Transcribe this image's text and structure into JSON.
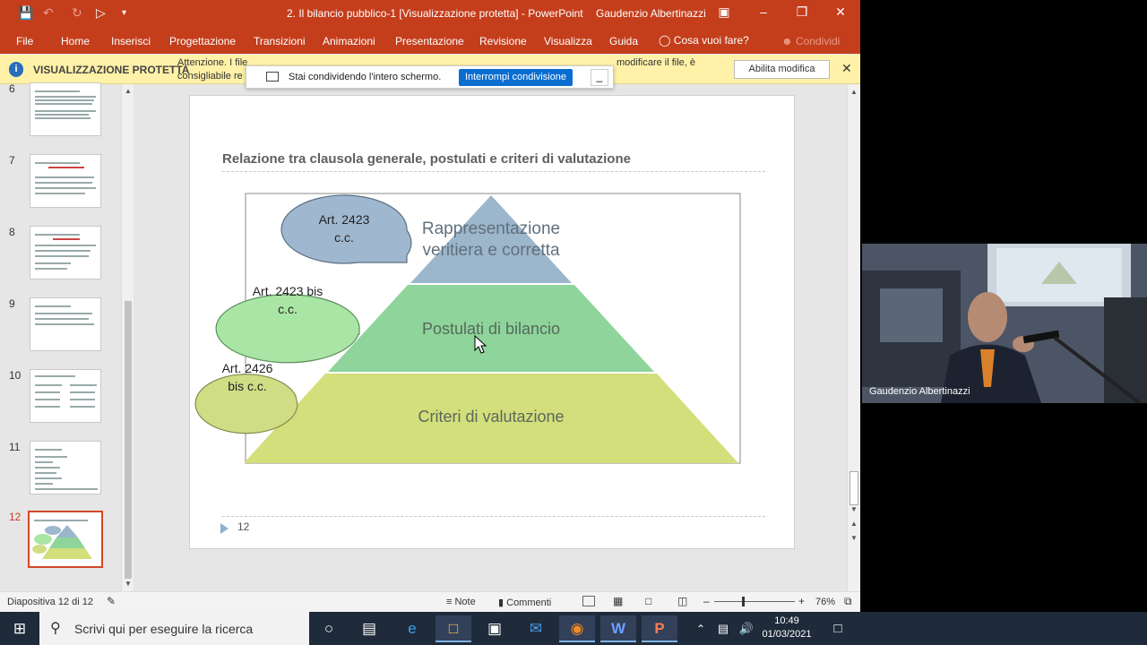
{
  "window": {
    "title": "2. Il bilancio pubblico-1 [Visualizzazione protetta]  -  PowerPoint",
    "user": "Gaudenzio Albertinazzi"
  },
  "ribbon": {
    "tabs": [
      "File",
      "Home",
      "Inserisci",
      "Progettazione",
      "Transizioni",
      "Animazioni",
      "Presentazione",
      "Revisione",
      "Visualizza",
      "Guida"
    ],
    "tell_me": "Cosa vuoi fare?",
    "share": "Condividi"
  },
  "protected_bar": {
    "title": "VISUALIZZAZIONE PROTETTA",
    "message_line1": "Attenzione. I file",
    "message_line1_tail": "modificare il file, è",
    "message_line2": "consigliabile re",
    "enable_button": "Abilita modifica"
  },
  "share_bar": {
    "text": "Stai condividendo l'intero schermo.",
    "stop_button": "Interrompi condivisione",
    "minimize": "_"
  },
  "thumbnails": [
    {
      "num": "6"
    },
    {
      "num": "7"
    },
    {
      "num": "8"
    },
    {
      "num": "9"
    },
    {
      "num": "10"
    },
    {
      "num": "11"
    },
    {
      "num": "12"
    }
  ],
  "slide": {
    "title": "Relazione tra clausola generale, postulati e criteri di valutazione",
    "page_number": "12",
    "pyramid": {
      "top_line1": "Rappresentazione",
      "top_line2": "veritiera e corretta",
      "middle": "Postulati di bilancio",
      "bottom": "Criteri di valutazione"
    },
    "callouts": [
      {
        "line1": "Art. 2423",
        "line2": "c.c."
      },
      {
        "line1": "Art. 2423 bis",
        "line2": "c.c."
      },
      {
        "line1": "Art. 2426",
        "line2": "bis c.c."
      }
    ],
    "colors": {
      "top": "#9cb6cc",
      "middle": "#8fd49b",
      "bottom": "#d3df7a",
      "callout1": "#9fb7cf",
      "callout2": "#a9e6a5",
      "callout3": "#cfdd85"
    }
  },
  "status_bar": {
    "slide_info": "Diapositiva 12 di 12",
    "notes": "Note",
    "comments": "Commenti",
    "zoom": "76%"
  },
  "webcam": {
    "name": "Gaudenzio Albertinazzi"
  },
  "taskbar": {
    "search_placeholder": "Scrivi qui per eseguire la ricerca",
    "time": "10:49",
    "date": "01/03/2021"
  }
}
